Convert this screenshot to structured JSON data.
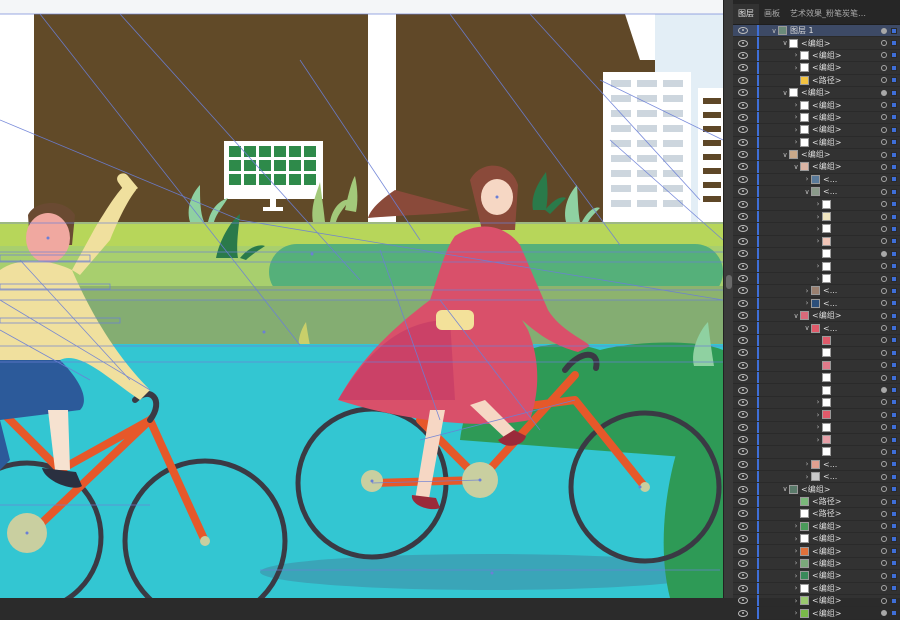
{
  "panel": {
    "tabs": [
      {
        "label": "图层",
        "active": true
      },
      {
        "label": "画板",
        "active": false
      },
      {
        "label": "艺术效果_粉笔炭笔铅笔",
        "active": false
      }
    ],
    "layers": [
      {
        "label": "图层 1",
        "depth": 0,
        "expand": "open",
        "thumb": "#6a8a7a",
        "selected": true,
        "target": "filled"
      },
      {
        "label": "<编组>",
        "depth": 1,
        "expand": "open",
        "thumb": "#ffffff"
      },
      {
        "label": "<编组>",
        "depth": 2,
        "expand": "closed",
        "thumb": "#ffffff"
      },
      {
        "label": "<编组>",
        "depth": 2,
        "expand": "closed",
        "thumb": "#ffffff"
      },
      {
        "label": "<路径>",
        "depth": 2,
        "expand": "none",
        "thumb": "#f3c341"
      },
      {
        "label": "<编组>",
        "depth": 1,
        "expand": "open",
        "thumb": "#ffffff",
        "target": "filled"
      },
      {
        "label": "<编组>",
        "depth": 2,
        "expand": "closed",
        "thumb": "#ffffff"
      },
      {
        "label": "<编组>",
        "depth": 2,
        "expand": "closed",
        "thumb": "#ffffff"
      },
      {
        "label": "<编组>",
        "depth": 2,
        "expand": "closed",
        "thumb": "#ffffff"
      },
      {
        "label": "<编组>",
        "depth": 2,
        "expand": "closed",
        "thumb": "#ffffff"
      },
      {
        "label": "<编组>",
        "depth": 1,
        "expand": "open",
        "thumb": "#c9a98a"
      },
      {
        "label": "<编组>",
        "depth": 2,
        "expand": "open",
        "thumb": "#d9b4a4"
      },
      {
        "label": "<...",
        "depth": 3,
        "expand": "closed",
        "thumb": "#5a7a9a"
      },
      {
        "label": "<...",
        "depth": 3,
        "expand": "open",
        "thumb": "#8a9a8a"
      },
      {
        "label": "",
        "depth": 4,
        "expand": "closed",
        "thumb": "#ffffff"
      },
      {
        "label": "",
        "depth": 4,
        "expand": "closed",
        "thumb": "#f1e6c0"
      },
      {
        "label": "",
        "depth": 4,
        "expand": "closed",
        "thumb": "#ffffff"
      },
      {
        "label": "",
        "depth": 4,
        "expand": "closed",
        "thumb": "#f2c6b8"
      },
      {
        "label": "",
        "depth": 4,
        "expand": "none",
        "thumb": "#ffffff",
        "target": "filled"
      },
      {
        "label": "",
        "depth": 4,
        "expand": "closed",
        "thumb": "#ffffff"
      },
      {
        "label": "",
        "depth": 4,
        "expand": "closed",
        "thumb": "#ffffff"
      },
      {
        "label": "<...",
        "depth": 3,
        "expand": "closed",
        "thumb": "#9a8070"
      },
      {
        "label": "<...",
        "depth": 3,
        "expand": "closed",
        "thumb": "#2c4f7a"
      },
      {
        "label": "<编组>",
        "depth": 2,
        "expand": "open",
        "thumb": "#d96a7a"
      },
      {
        "label": "<...",
        "depth": 3,
        "expand": "open",
        "thumb": "#e05a6a"
      },
      {
        "label": "",
        "depth": 4,
        "expand": "none",
        "thumb": "#e05a6a"
      },
      {
        "label": "",
        "depth": 4,
        "expand": "none",
        "thumb": "#ffffff"
      },
      {
        "label": "",
        "depth": 4,
        "expand": "none",
        "thumb": "#e07a8a"
      },
      {
        "label": "",
        "depth": 4,
        "expand": "none",
        "thumb": "#ffffff"
      },
      {
        "label": "",
        "depth": 4,
        "expand": "none",
        "thumb": "#ffffff",
        "target": "filled"
      },
      {
        "label": "",
        "depth": 4,
        "expand": "closed",
        "thumb": "#ffffff"
      },
      {
        "label": "",
        "depth": 4,
        "expand": "closed",
        "thumb": "#e05a6a"
      },
      {
        "label": "",
        "depth": 4,
        "expand": "closed",
        "thumb": "#ffffff"
      },
      {
        "label": "",
        "depth": 4,
        "expand": "closed",
        "thumb": "#e7a0a8"
      },
      {
        "label": "",
        "depth": 4,
        "expand": "none",
        "thumb": "#ffffff"
      },
      {
        "label": "<...",
        "depth": 3,
        "expand": "closed",
        "thumb": "#e0a090"
      },
      {
        "label": "<...",
        "depth": 3,
        "expand": "closed",
        "thumb": "#c8c8c8"
      },
      {
        "label": "<编组>",
        "depth": 1,
        "expand": "open",
        "thumb": "#5a7a6a"
      },
      {
        "label": "<路径>",
        "depth": 2,
        "expand": "none",
        "thumb": "#7ab87a"
      },
      {
        "label": "<路径>",
        "depth": 2,
        "expand": "none",
        "thumb": "#ffffff"
      },
      {
        "label": "<编组>",
        "depth": 2,
        "expand": "closed",
        "thumb": "#4a9a5a"
      },
      {
        "label": "<编组>",
        "depth": 2,
        "expand": "closed",
        "thumb": "#ffffff"
      },
      {
        "label": "<编组>",
        "depth": 2,
        "expand": "closed",
        "thumb": "#e0703a"
      },
      {
        "label": "<编组>",
        "depth": 2,
        "expand": "closed",
        "thumb": "#7aa87a"
      },
      {
        "label": "<编组>",
        "depth": 2,
        "expand": "closed",
        "thumb": "#3a8a5a"
      },
      {
        "label": "<编组>",
        "depth": 2,
        "expand": "closed",
        "thumb": "#ffffff"
      },
      {
        "label": "<编组>",
        "depth": 2,
        "expand": "closed",
        "thumb": "#9ac870"
      },
      {
        "label": "<编组>",
        "depth": 2,
        "expand": "closed",
        "thumb": "#7ab84a",
        "target": "filled"
      }
    ]
  }
}
